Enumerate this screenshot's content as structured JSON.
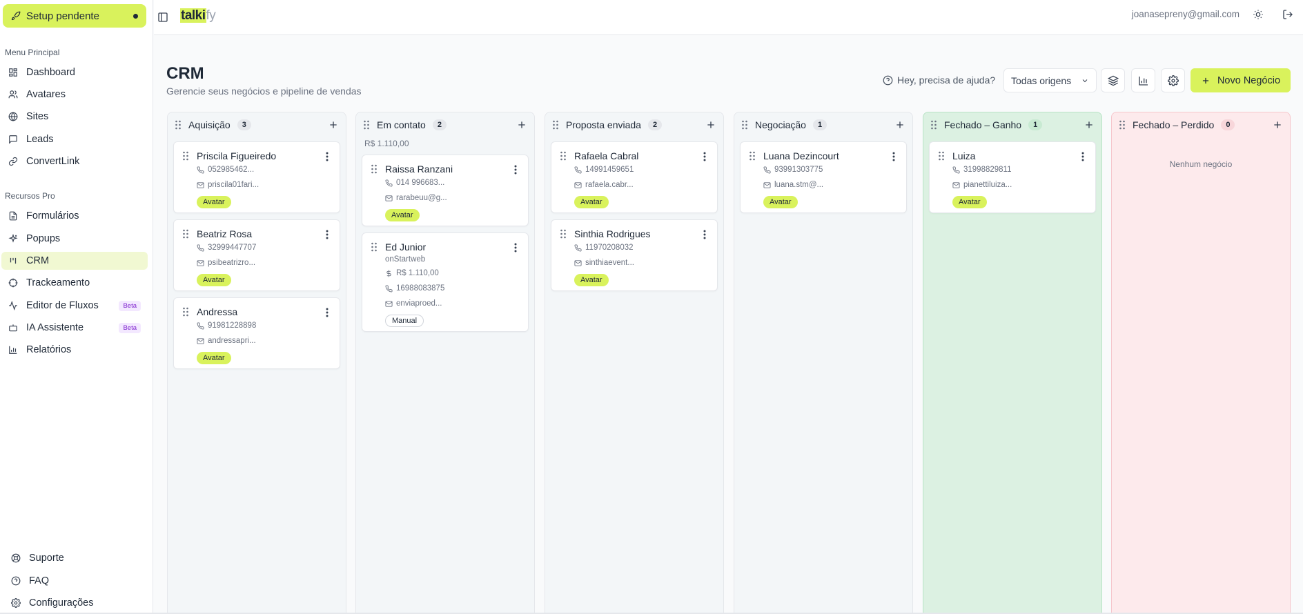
{
  "sidebar": {
    "setup_label": "Setup pendente",
    "menu_principal": "Menu Principal",
    "main_items": [
      {
        "label": "Dashboard",
        "icon": "grid-icon"
      },
      {
        "label": "Avatares",
        "icon": "users-icon"
      },
      {
        "label": "Sites",
        "icon": "globe-icon"
      },
      {
        "label": "Leads",
        "icon": "chat-icon"
      },
      {
        "label": "ConvertLink",
        "icon": "link-icon"
      }
    ],
    "recursos_pro": "Recursos Pro",
    "pro_items": [
      {
        "label": "Formulários",
        "icon": "file-icon"
      },
      {
        "label": "Popups",
        "icon": "sparkle-icon"
      },
      {
        "label": "CRM",
        "icon": "kanban-icon",
        "active": true
      },
      {
        "label": "Trackeamento",
        "icon": "target-icon"
      },
      {
        "label": "Editor de Fluxos",
        "icon": "flow-icon",
        "badge": "Beta"
      },
      {
        "label": "IA Assistente",
        "icon": "bot-icon",
        "badge": "Beta"
      },
      {
        "label": "Relatórios",
        "icon": "chart-icon"
      }
    ],
    "bottom_items": [
      {
        "label": "Suporte",
        "icon": "lifebuoy-icon"
      },
      {
        "label": "FAQ",
        "icon": "help-icon"
      },
      {
        "label": "Configurações",
        "icon": "gear-icon"
      }
    ]
  },
  "topbar": {
    "logo_a": "talki",
    "logo_b": "fy",
    "email": "joanasepreny@gmail.com"
  },
  "header": {
    "title": "CRM",
    "subtitle": "Gerencie seus negócios e pipeline de vendas",
    "help": "Hey, precisa de ajuda?",
    "origin_select": "Todas origens",
    "new_deal": "Novo Negócio"
  },
  "columns": [
    {
      "name": "Aquisição",
      "count": "3",
      "total": "",
      "theme": "default",
      "cards": [
        {
          "name": "Priscila Figueiredo",
          "phone": "052985462...",
          "email": "priscila01fari...",
          "tag": "Avatar"
        },
        {
          "name": "Beatriz Rosa",
          "phone": "32999447707",
          "email": "psibeatrizro...",
          "tag": "Avatar"
        },
        {
          "name": "Andressa",
          "phone": "91981228898",
          "email": "andressapri...",
          "tag": "Avatar"
        }
      ]
    },
    {
      "name": "Em contato",
      "count": "2",
      "total": "R$ 1.110,00",
      "theme": "default",
      "cards": [
        {
          "name": "Raissa Ranzani",
          "phone": "014 996683...",
          "email": "rarabeuu@g...",
          "tag": "Avatar"
        },
        {
          "name": "Ed Junior",
          "company": "onStartweb",
          "value": "R$ 1.110,00",
          "phone": "16988083875",
          "email": "enviaproed...",
          "tag": "Manual"
        }
      ]
    },
    {
      "name": "Proposta enviada",
      "count": "2",
      "total": "",
      "theme": "default",
      "cards": [
        {
          "name": "Rafaela Cabral",
          "phone": "14991459651",
          "email": "rafaela.cabr...",
          "tag": "Avatar"
        },
        {
          "name": "Sinthia Rodrigues",
          "phone": "11970208032",
          "email": "sinthiaevent...",
          "tag": "Avatar"
        }
      ]
    },
    {
      "name": "Negociação",
      "count": "1",
      "total": "",
      "theme": "default",
      "cards": [
        {
          "name": "Luana Dezincourt",
          "phone": "93991303775",
          "email": "luana.stm@...",
          "tag": "Avatar"
        }
      ]
    },
    {
      "name": "Fechado – Ganho",
      "count": "1",
      "total": "",
      "theme": "won",
      "cards": [
        {
          "name": "Luiza",
          "phone": "31998829811",
          "email": "pianettiluiza...",
          "tag": "Avatar"
        }
      ]
    },
    {
      "name": "Fechado – Perdido",
      "count": "0",
      "total": "",
      "theme": "lost",
      "empty": "Nenhum negócio",
      "cards": []
    }
  ],
  "colors": {
    "accent": "#d9f25c",
    "won_bg": "#dcf1e2",
    "lost_bg": "#fdeaec"
  }
}
